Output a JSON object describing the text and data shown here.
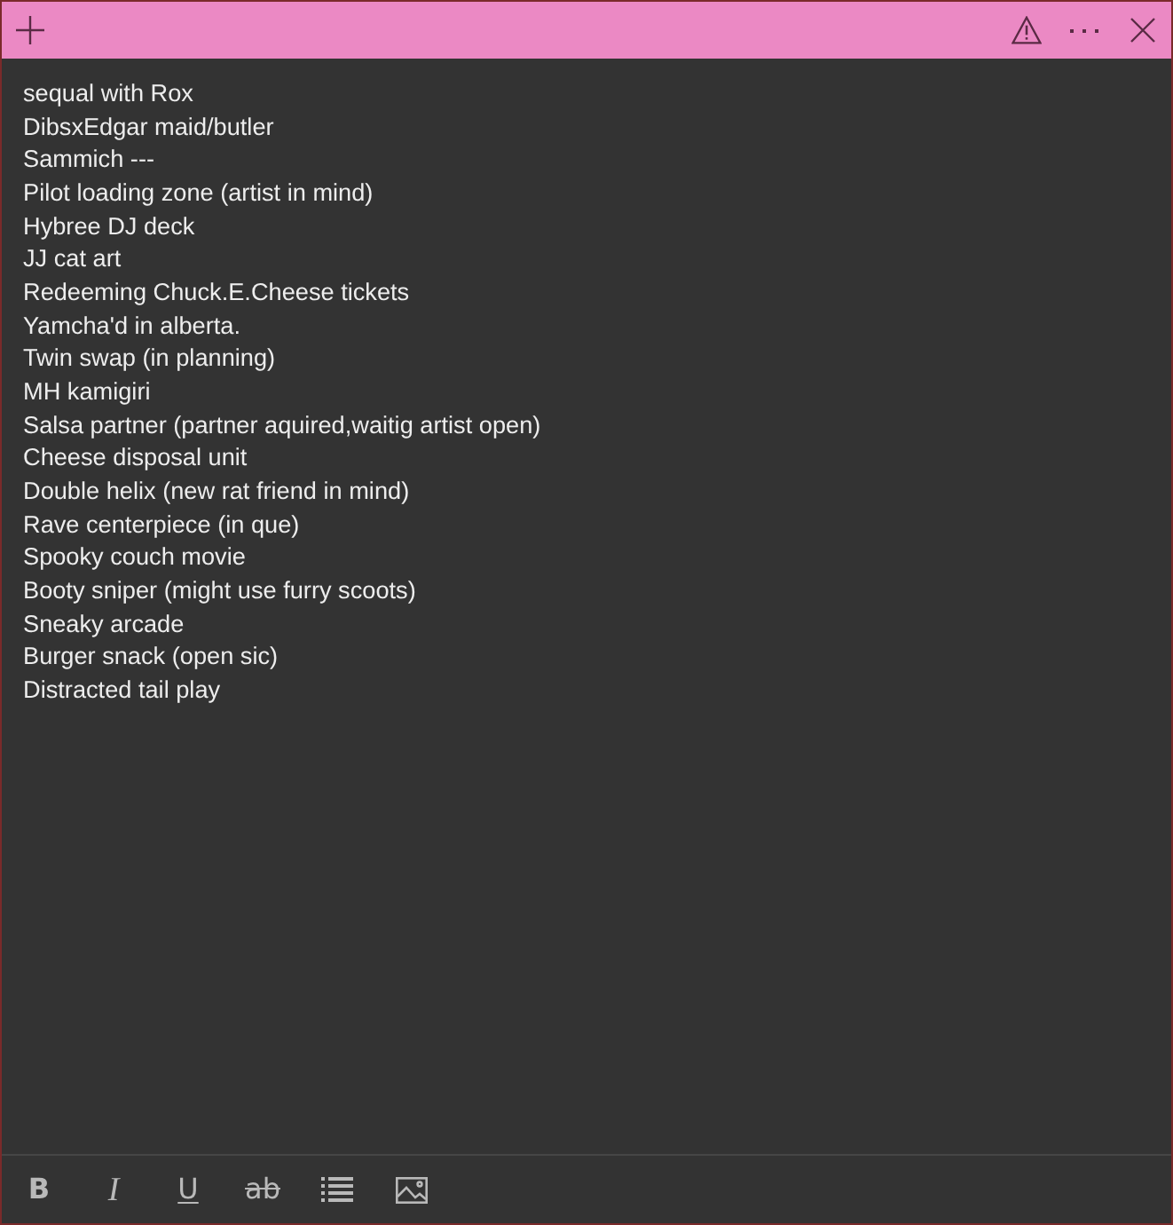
{
  "note": {
    "lines": [
      "sequal with Rox",
      "DibsxEdgar maid/butler",
      "Sammich ---",
      "Pilot loading zone (artist in mind)",
      "Hybree DJ deck",
      "JJ cat art",
      "Redeeming Chuck.E.Cheese tickets",
      "Yamcha'd in alberta.",
      "Twin swap (in planning)",
      "MH kamigiri",
      "Salsa partner (partner aquired,waitig artist open)",
      "Cheese disposal unit",
      "Double helix (new rat friend in mind)",
      "Rave centerpiece (in que)",
      "Spooky couch movie",
      "Booty sniper (might use furry scoots)",
      "Sneaky arcade",
      "Burger snack (open sic)",
      "Distracted tail play"
    ]
  },
  "toolbar": [
    {
      "kind": "bold",
      "label": "B"
    },
    {
      "kind": "italic",
      "label": "I"
    },
    {
      "kind": "underline",
      "label": "U"
    },
    {
      "kind": "strikethrough",
      "label": "ab"
    },
    {
      "kind": "list"
    },
    {
      "kind": "image"
    }
  ]
}
